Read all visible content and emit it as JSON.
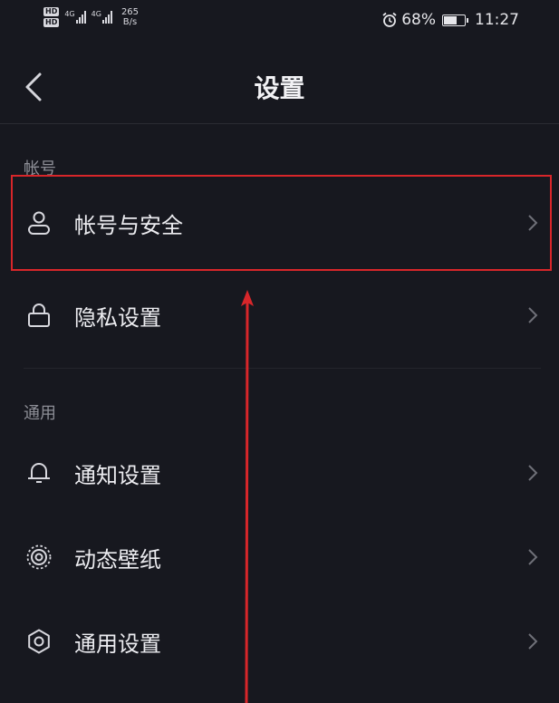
{
  "status_bar": {
    "hd_badges": [
      "HD",
      "HD"
    ],
    "signal_tags": [
      "4G",
      "4G"
    ],
    "net_speed_value": "265",
    "net_speed_unit": "B/s",
    "battery_percent": "68%",
    "battery_level": 0.68,
    "time": "11:27",
    "icons": [
      "alarm-icon",
      "battery-icon",
      "signal-icon"
    ]
  },
  "header": {
    "back_icon": "chevron-left-icon",
    "title": "设置"
  },
  "sections": [
    {
      "label": "帐号",
      "items": [
        {
          "label": "帐号与安全",
          "icon": "person-icon",
          "highlighted": true
        },
        {
          "label": "隐私设置",
          "icon": "lock-icon",
          "highlighted": false
        }
      ]
    },
    {
      "label": "通用",
      "items": [
        {
          "label": "通知设置",
          "icon": "bell-icon",
          "highlighted": false
        },
        {
          "label": "动态壁纸",
          "icon": "wallpaper-icon",
          "highlighted": false
        },
        {
          "label": "通用设置",
          "icon": "gear-icon",
          "highlighted": false
        }
      ]
    }
  ],
  "colors": {
    "background": "#17181f",
    "highlight": "#d8262a",
    "text": "#ececf0",
    "muted": "#8d8e96"
  }
}
